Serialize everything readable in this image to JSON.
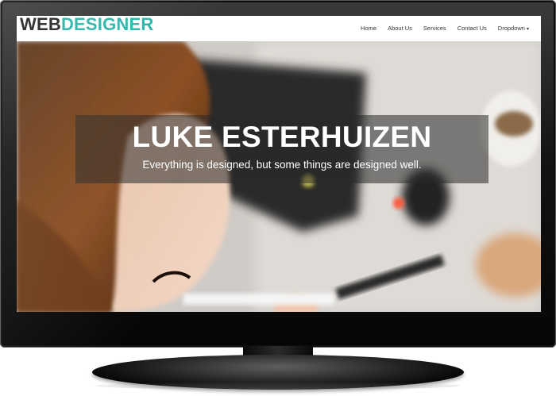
{
  "brand": {
    "part1": "WEB",
    "part2": "DESIGNER"
  },
  "nav": {
    "items": [
      {
        "label": "Home"
      },
      {
        "label": "About Us"
      },
      {
        "label": "Services"
      },
      {
        "label": "Contact Us"
      },
      {
        "label": "Dropdown"
      }
    ],
    "dropdown_caret": "▾"
  },
  "hero": {
    "title": "LUKE ESTERHUIZEN",
    "subtitle": "Everything is designed, but some things are designed well."
  },
  "colors": {
    "brand_dark": "#222222",
    "brand_accent": "#2bb5a8",
    "overlay": "rgba(40,40,40,0.55)"
  }
}
